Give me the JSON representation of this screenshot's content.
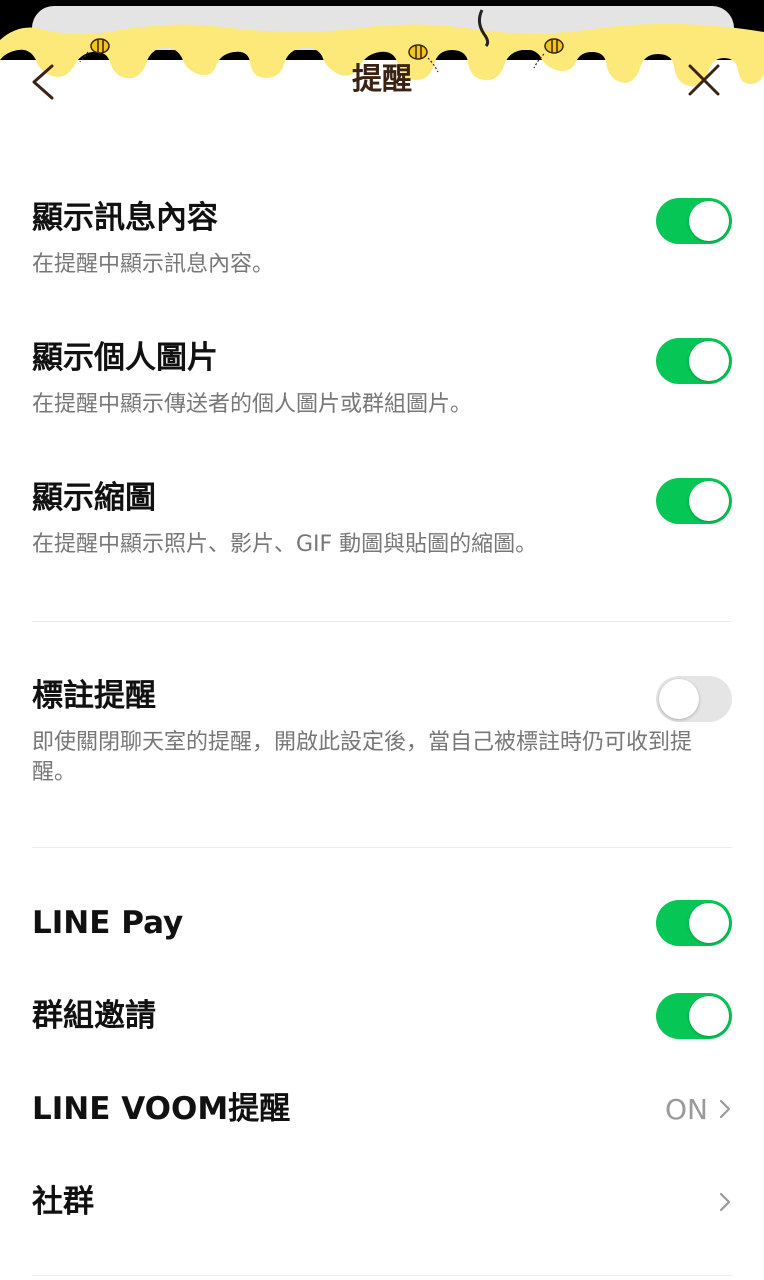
{
  "header": {
    "title": "提醒",
    "back_icon": "chevron-left-icon",
    "close_icon": "close-icon",
    "theme_colors": {
      "honey": "#fce97a",
      "bee": "#f5c518",
      "title": "#3a2314"
    }
  },
  "settings": {
    "show_message": {
      "title": "顯示訊息內容",
      "desc": "在提醒中顯示訊息內容。",
      "enabled": true
    },
    "show_profile": {
      "title": "顯示個人圖片",
      "desc": "在提醒中顯示傳送者的個人圖片或群組圖片。",
      "enabled": true
    },
    "show_thumbnail": {
      "title": "顯示縮圖",
      "desc": "在提醒中顯示照片、影片、GIF 動圖與貼圖的縮圖。",
      "enabled": true
    },
    "mention": {
      "title": "標註提醒",
      "desc": "即使關閉聊天室的提醒，開啟此設定後，當自己被標註時仍可收到提醒。",
      "enabled": false
    },
    "line_pay": {
      "title": "LINE Pay",
      "enabled": true
    },
    "group_invite": {
      "title": "群組邀請",
      "enabled": true
    },
    "line_voom": {
      "title": "LINE VOOM提醒",
      "value": "ON"
    },
    "community": {
      "title": "社群"
    }
  },
  "colors": {
    "toggle_on": "#06c755",
    "toggle_off": "#e5e5e5",
    "desc_text": "#777777"
  }
}
